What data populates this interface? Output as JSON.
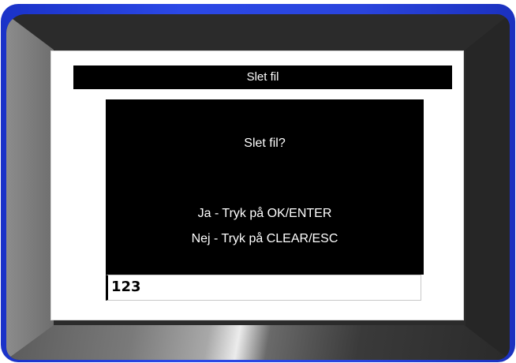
{
  "dialog": {
    "title": "Slet fil",
    "question": "Slet fil?",
    "yes_instruction": "Ja - Tryk på OK/ENTER",
    "no_instruction": "Nej - Tryk på CLEAR/ESC"
  },
  "input": {
    "value": "123"
  },
  "colors": {
    "frame": "#2b48e6",
    "screen_background": "#ffffff",
    "dialog_background": "#000000",
    "dialog_text": "#ffffff"
  }
}
